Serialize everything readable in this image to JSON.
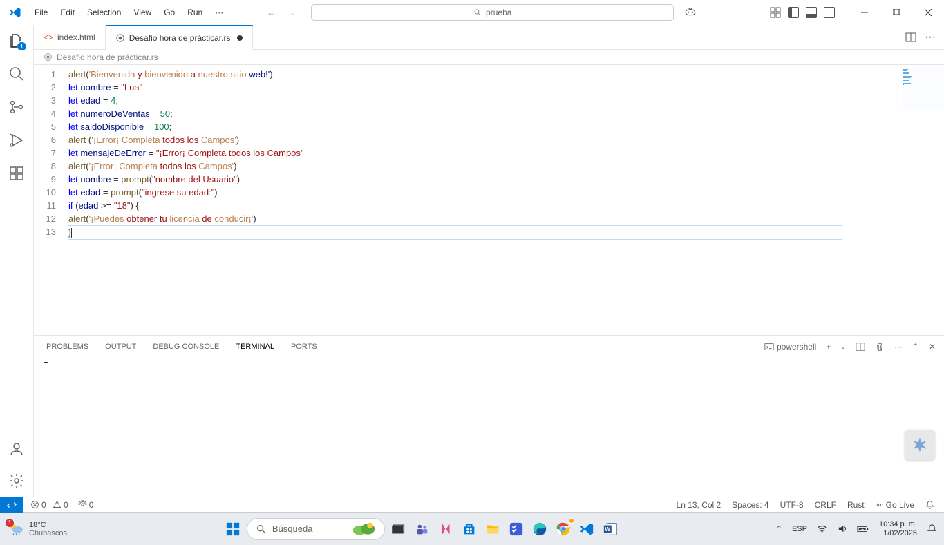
{
  "menus": [
    "File",
    "Edit",
    "Selection",
    "View",
    "Go",
    "Run"
  ],
  "search": {
    "text": "prueba"
  },
  "tabs": [
    {
      "label": "index.html",
      "active": false,
      "dirty": false
    },
    {
      "label": "Desafio hora de prácticar.rs",
      "active": true,
      "dirty": true
    }
  ],
  "breadcrumb": "Desafio hora de prácticar.rs",
  "code": {
    "lines": [
      1,
      2,
      3,
      4,
      5,
      6,
      7,
      8,
      9,
      10,
      11,
      12,
      13
    ]
  },
  "code_tokens": {
    "l1": {
      "fn": "alert",
      "p": "(",
      "s1": "'Bienvenida ",
      "s2": "y",
      "s3": " bienvenido ",
      "s4": "a",
      "s5": " nuestro sitio ",
      "s6": "web!'",
      "p2": ");"
    },
    "l2": {
      "kw": "let",
      "sp": " ",
      "id": "nombre",
      "op": " = ",
      "str": "\"Lua\""
    },
    "l3": {
      "kw": "let",
      "sp": " ",
      "id": "edad",
      "op": " = ",
      "num": "4",
      "sc": ";"
    },
    "l4": {
      "kw": "let",
      "sp": " ",
      "id": "numeroDeVentas",
      "op": " = ",
      "num": "50",
      "sc": ";"
    },
    "l5": {
      "kw": "let",
      "sp": " ",
      "id": "saldoDisponible",
      "op": " = ",
      "num": "100",
      "sc": ";"
    },
    "l6": {
      "fn": "alert",
      "sp": " ",
      "p": "(",
      "s1": "'¡Error¡ Completa ",
      "s2": "todos",
      "s3": " ",
      "s4": "los",
      "s5": " Campos'",
      "p2": ")"
    },
    "l7": {
      "kw": "let",
      "sp": " ",
      "id": "mensajeDeError",
      "op": " = ",
      "str": "\"¡Error¡ Completa todos los Campos\""
    },
    "l8": {
      "fn": "alert",
      "p": "(",
      "s1": "'¡Error¡ Completa ",
      "s2": "todos",
      "s3": " ",
      "s4": "los",
      "s5": " Campos'",
      "p2": ")"
    },
    "l9": {
      "kw": "let",
      "sp": " ",
      "id": "nombre",
      "op": " = ",
      "fn": "prompt",
      "p": "(",
      "str": "\"nombre del Usuario\"",
      "p2": ")"
    },
    "l10": {
      "kw": "let",
      "sp": " ",
      "id": "edad",
      "op": " = ",
      "fn": "prompt",
      "p": "(",
      "str": "\"ingrese su edad:\"",
      "p2": ")"
    },
    "l11": {
      "kw": "if",
      "sp": " ",
      "p": "(",
      "id": "edad",
      "op": " >= ",
      "str": "\"18\"",
      "p2": ") {"
    },
    "l12": {
      "fn": "alert",
      "p": "(",
      "s1": "'¡Puedes ",
      "s2": "obtener",
      "s3": " ",
      "s4": "tu",
      "s5": " licencia ",
      "s6": "de",
      "s7": " conducir¡'",
      "p2": ")"
    },
    "l13": {
      "br": "}"
    }
  },
  "panel": {
    "tabs": [
      "PROBLEMS",
      "OUTPUT",
      "DEBUG CONSOLE",
      "TERMINAL",
      "PORTS"
    ],
    "active": "TERMINAL",
    "shell": "powershell"
  },
  "status": {
    "errors": "0",
    "warnings": "0",
    "ports": "0",
    "pos": "Ln 13, Col 2",
    "spaces": "Spaces: 4",
    "enc": "UTF-8",
    "eol": "CRLF",
    "lang": "Rust",
    "golive": "Go Live"
  },
  "taskbar": {
    "temp": "18°C",
    "weather": "Chubascos",
    "search_placeholder": "Búsqueda",
    "lang": "ESP",
    "time": "10:34 p. m.",
    "date": "1/02/2025"
  },
  "activity_badge": "1"
}
